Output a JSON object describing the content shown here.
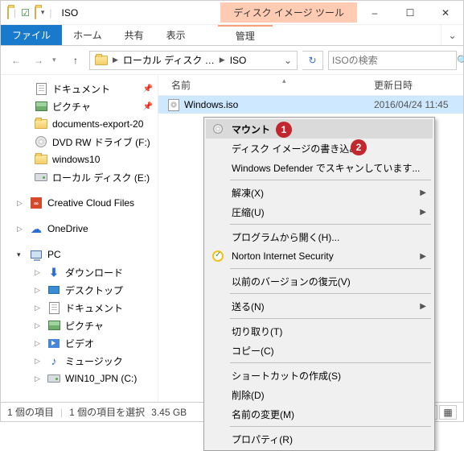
{
  "titlebar": {
    "title": "ISO",
    "context_tool_label": "ディスク イメージ ツール"
  },
  "ribbon": {
    "file": "ファイル",
    "home": "ホーム",
    "share": "共有",
    "view": "表示",
    "context_manage": "管理"
  },
  "nav": {
    "breadcrumb_seg1": "ローカル ディスク …",
    "breadcrumb_seg2": "ISO",
    "search_placeholder": "ISOの検索"
  },
  "sidebar": {
    "quick": [
      {
        "label": "ドキュメント",
        "icon": "doc",
        "pinned": true
      },
      {
        "label": "ピクチャ",
        "icon": "pic",
        "pinned": true
      },
      {
        "label": "documents-export-20",
        "icon": "folder",
        "pinned": false
      },
      {
        "label": "DVD RW ドライブ (F:)",
        "icon": "disc",
        "pinned": false
      },
      {
        "label": "windows10",
        "icon": "folder",
        "pinned": false
      },
      {
        "label": "ローカル ディスク (E:)",
        "icon": "drive",
        "pinned": false
      }
    ],
    "cc_label": "Creative Cloud Files",
    "onedrive_label": "OneDrive",
    "pc_label": "PC",
    "pc_children": [
      {
        "label": "ダウンロード",
        "icon": "dl"
      },
      {
        "label": "デスクトップ",
        "icon": "desktop"
      },
      {
        "label": "ドキュメント",
        "icon": "doc"
      },
      {
        "label": "ピクチャ",
        "icon": "pic"
      },
      {
        "label": "ビデオ",
        "icon": "video"
      },
      {
        "label": "ミュージック",
        "icon": "music"
      },
      {
        "label": "WIN10_JPN (C:)",
        "icon": "drive"
      }
    ]
  },
  "columns": {
    "name": "名前",
    "date": "更新日時"
  },
  "files": [
    {
      "name": "Windows.iso",
      "date": "2016/04/24 11:45"
    }
  ],
  "context_menu": {
    "mount": "マウント",
    "burn": "ディスク イメージの書き込み",
    "defender": "Windows Defender でスキャンしています...",
    "extract": "解凍(X)",
    "compress": "圧縮(U)",
    "open_with": "プログラムから開く(H)...",
    "norton": "Norton Internet Security",
    "prev_ver": "以前のバージョンの復元(V)",
    "send_to": "送る(N)",
    "cut": "切り取り(T)",
    "copy": "コピー(C)",
    "shortcut": "ショートカットの作成(S)",
    "delete": "削除(D)",
    "rename": "名前の変更(M)",
    "properties": "プロパティ(R)"
  },
  "status": {
    "items": "1 個の項目",
    "selected": "1 個の項目を選択",
    "size": "3.45 GB"
  },
  "annotations": {
    "a1": "1",
    "a2": "2"
  }
}
